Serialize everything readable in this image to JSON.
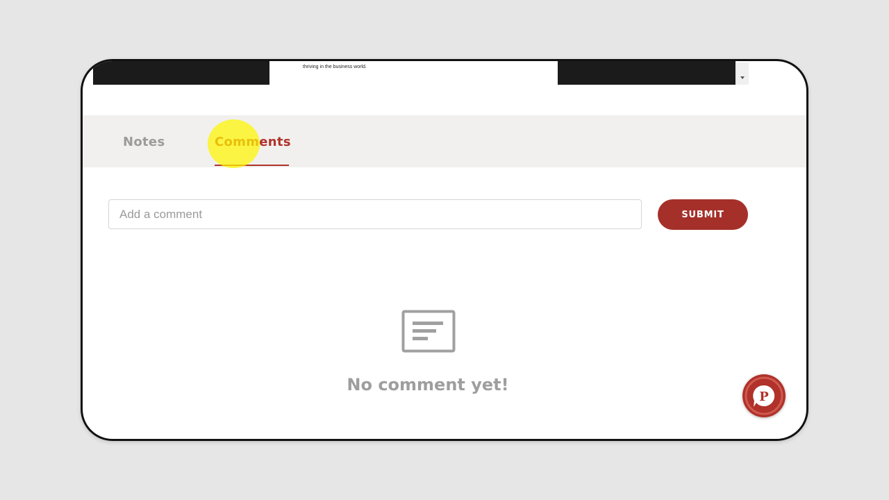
{
  "media": {
    "slide_text": "thriving in the business world."
  },
  "tabs": [
    {
      "label": "Notes",
      "active": false
    },
    {
      "label": "Comments",
      "active": true
    }
  ],
  "comment_form": {
    "value": "",
    "placeholder": "Add a comment",
    "submit_label": "SUBMIT"
  },
  "empty_state": {
    "icon": "comment-card-icon",
    "message": "No comment yet!"
  },
  "chat_widget": {
    "icon": "chat-bubble-icon",
    "letter": "P"
  },
  "colors": {
    "accent": "#b0322a",
    "button": "#a5302a",
    "tab_inactive": "#9b9b9b",
    "tabbar_bg": "#f1f0ee",
    "highlight": "#fff500"
  }
}
